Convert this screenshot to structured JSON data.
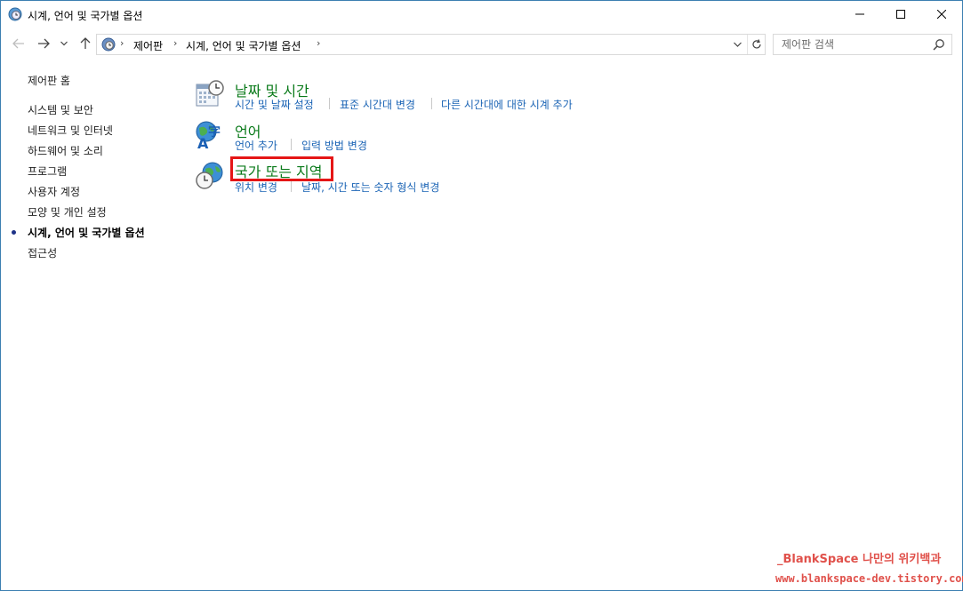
{
  "window": {
    "title": "시계, 언어 및 국가별 옵션"
  },
  "address_bar": {
    "crumbs": [
      "제어판",
      "시계, 언어 및 국가별 옵션"
    ]
  },
  "search": {
    "placeholder": "제어판 검색"
  },
  "sidebar": {
    "home": "제어판 홈",
    "items": [
      {
        "label": "시스템 및 보안",
        "active": false
      },
      {
        "label": "네트워크 및 인터넷",
        "active": false
      },
      {
        "label": "하드웨어 및 소리",
        "active": false
      },
      {
        "label": "프로그램",
        "active": false
      },
      {
        "label": "사용자 계정",
        "active": false
      },
      {
        "label": "모양 및 개인 설정",
        "active": false
      },
      {
        "label": "시계, 언어 및 국가별 옵션",
        "active": true
      },
      {
        "label": "접근성",
        "active": false
      }
    ]
  },
  "categories": [
    {
      "title": "날짜 및 시간",
      "icon": "calendar-clock-icon",
      "links": [
        "시간 및 날짜 설정",
        "표준 시간대 변경",
        "다른 시간대에 대한 시계 추가"
      ]
    },
    {
      "title": "언어",
      "icon": "language-globe-icon",
      "links": [
        "언어 추가",
        "입력 방법 변경"
      ]
    },
    {
      "title": "국가 또는 지역",
      "icon": "globe-clock-icon",
      "links": [
        "위치 변경",
        "날짜, 시간 또는 숫자 형식 변경"
      ],
      "highlighted": true
    }
  ],
  "watermark": {
    "line1": "_BlankSpace 나만의 위키백과",
    "line2": "www.blankspace-dev.tistory.com"
  },
  "colors": {
    "category_title": "#0a7a1a",
    "link": "#1b64b5",
    "highlight": "#e51616",
    "watermark": "#e0514b"
  }
}
